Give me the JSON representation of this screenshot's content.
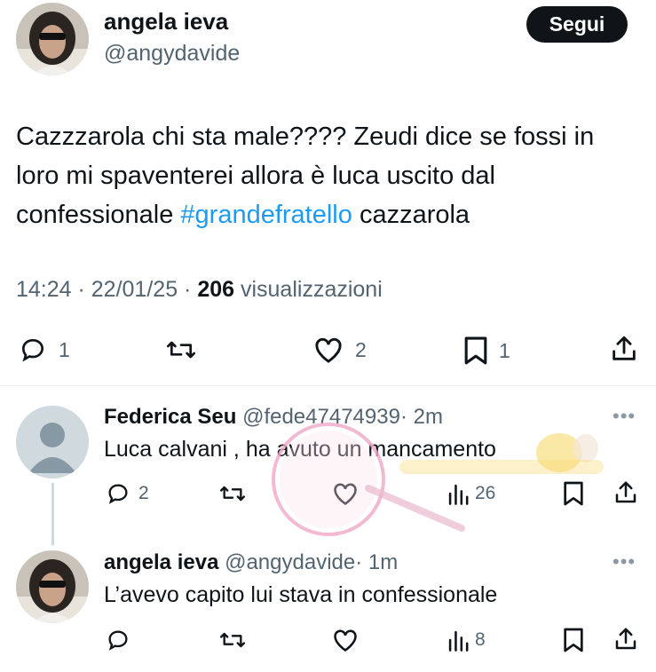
{
  "colors": {
    "accent": "#1d9bf0",
    "text": "#0f1419",
    "muted": "#536471",
    "button_bg": "#0f1419"
  },
  "main_tweet": {
    "author_name": "angela ieva",
    "author_handle": "@angydavide",
    "follow_label": "Segui",
    "text_before_hashtag": "Cazzzarola chi sta male???? Zeudi dice se fossi in loro mi spaventerei  allora è luca uscito dal confessionale ",
    "hashtag": "#grandefratello",
    "text_after_hashtag": "  cazzarola",
    "timestamp": "14:24 · 22/01/25 · ",
    "views_count": "206",
    "views_label": " visualizzazioni",
    "reply_count": "1",
    "retweet_count": "",
    "like_count": "2",
    "bookmark_count": "1"
  },
  "replies": [
    {
      "author_name": "Federica Seu",
      "author_handle": "@fede47474939",
      "time": "· 2m",
      "text": "Luca calvani , ha avuto un mancamento",
      "reply_count": "2",
      "views_count": "26",
      "icons": [
        "reply-icon",
        "retweet-icon",
        "like-icon",
        "views-icon",
        "bookmark-icon",
        "share-icon"
      ]
    },
    {
      "author_name": "angela ieva",
      "author_handle": "@angydavide",
      "time": "· 1m",
      "text": "L’avevo capito lui stava in  confessionale",
      "views_count": "8",
      "icons": [
        "reply-icon",
        "retweet-icon",
        "like-icon",
        "views-icon",
        "bookmark-icon",
        "share-icon"
      ]
    }
  ],
  "more_label": "•••"
}
